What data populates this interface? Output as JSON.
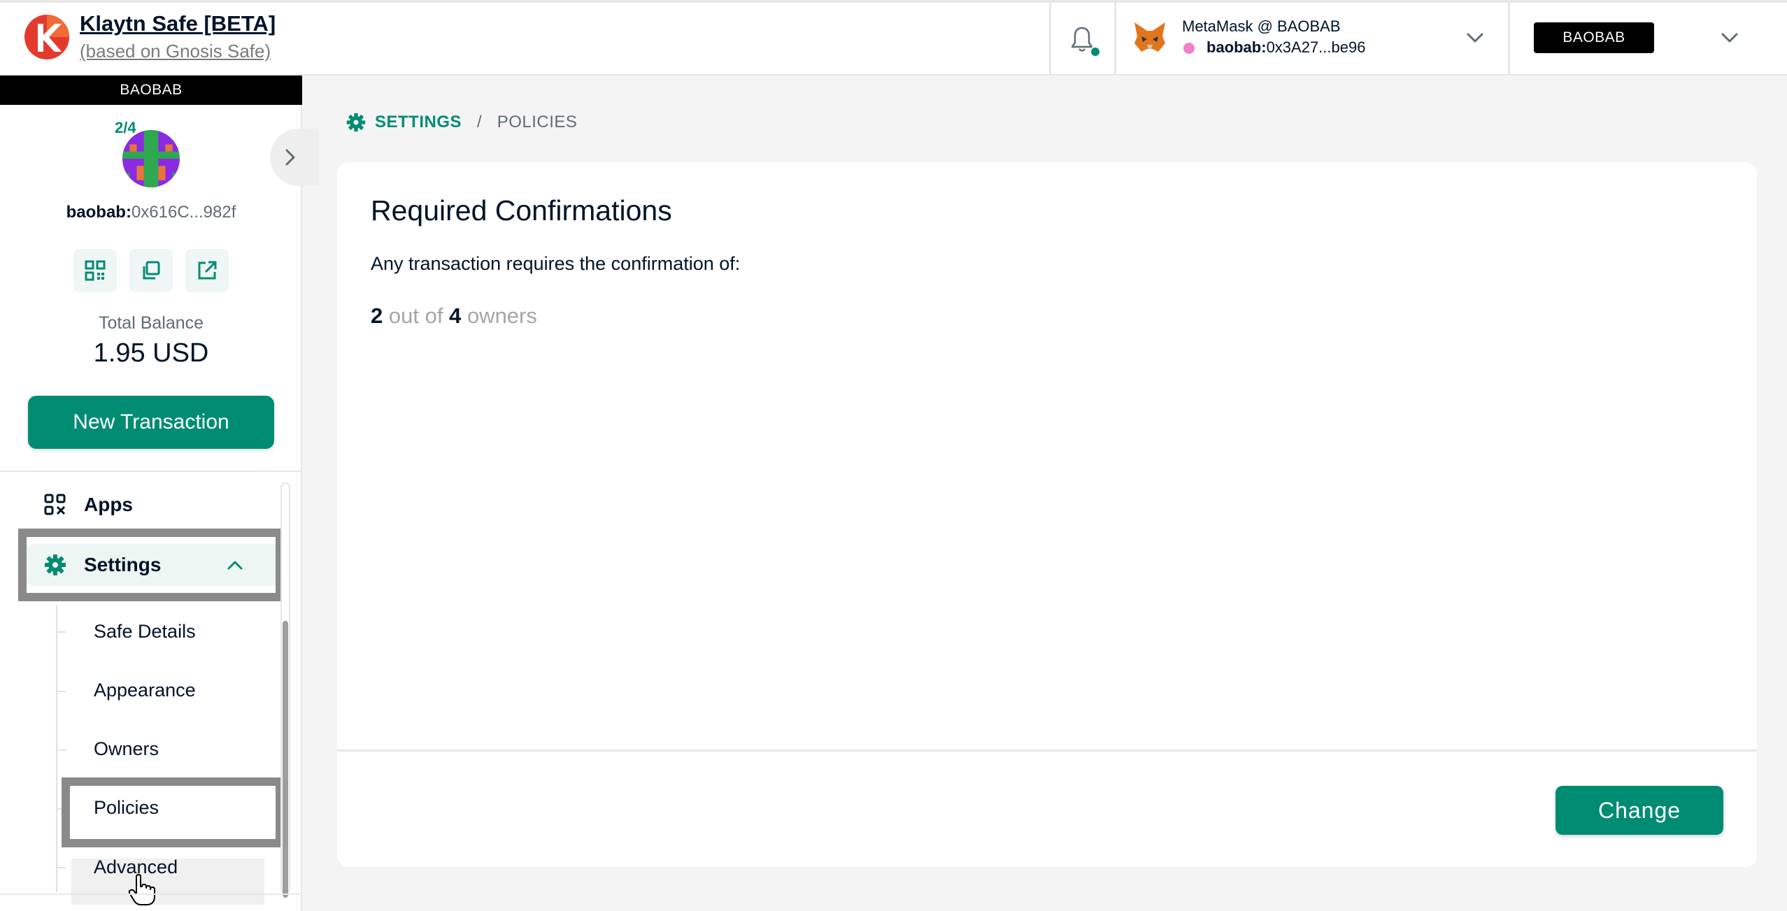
{
  "header": {
    "title": "Klaytn Safe [BETA]",
    "subtitle": "(based on Gnosis Safe)",
    "wallet": {
      "name": "MetaMask @ BAOBAB",
      "prefix": "baobab:",
      "address": "0x3A27...be96"
    },
    "network": "BAOBAB",
    "icons": [
      "klaytn-logo-icon",
      "bell-icon",
      "metamask-fox-icon",
      "chevron-down-icon"
    ]
  },
  "sidebar": {
    "network": "BAOBAB",
    "threshold": "2/4",
    "safe": {
      "prefix": "baobab:",
      "address": "0x616C...982f"
    },
    "actions": [
      "qr-code-icon",
      "copy-icon",
      "external-link-icon"
    ],
    "balance_label": "Total Balance",
    "balance_value": "1.95 USD",
    "new_transaction": "New Transaction",
    "nav": {
      "apps": "Apps",
      "settings": "Settings",
      "sub_items": [
        "Safe Details",
        "Appearance",
        "Owners",
        "Policies",
        "Advanced"
      ]
    }
  },
  "breadcrumb": {
    "section": "SETTINGS",
    "separator": "/",
    "current": "POLICIES"
  },
  "card": {
    "title": "Required Confirmations",
    "description": "Any transaction requires the confirmation of:",
    "required": "2",
    "out_of_text": "out of",
    "total": "4",
    "owners_text": "owners",
    "change_button": "Change"
  },
  "colors": {
    "accent": "#008c73",
    "text": "#001428",
    "muted": "#a6a6a6",
    "background": "#f4f4f4"
  }
}
